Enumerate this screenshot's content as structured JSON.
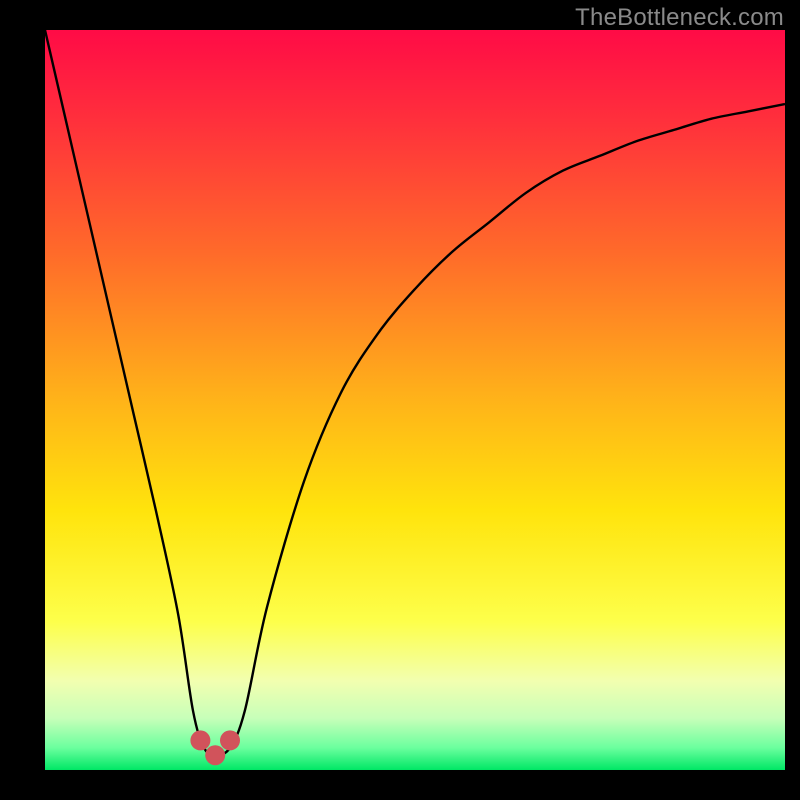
{
  "watermark": "TheBottleneck.com",
  "chart_data": {
    "type": "line",
    "title": "",
    "xlabel": "",
    "ylabel": "",
    "xlim": [
      0,
      100
    ],
    "ylim": [
      0,
      100
    ],
    "legend": false,
    "grid": false,
    "background": {
      "gradient_stops": [
        {
          "pos": 0.0,
          "color": "#ff0b46"
        },
        {
          "pos": 0.12,
          "color": "#ff2f3c"
        },
        {
          "pos": 0.3,
          "color": "#ff6a2a"
        },
        {
          "pos": 0.5,
          "color": "#ffb319"
        },
        {
          "pos": 0.65,
          "color": "#ffe40c"
        },
        {
          "pos": 0.8,
          "color": "#fdff4b"
        },
        {
          "pos": 0.88,
          "color": "#f2ffb0"
        },
        {
          "pos": 0.93,
          "color": "#c7ffb9"
        },
        {
          "pos": 0.97,
          "color": "#6bff9e"
        },
        {
          "pos": 1.0,
          "color": "#00e765"
        }
      ]
    },
    "series": [
      {
        "name": "bottleneck-curve",
        "x": [
          0,
          3,
          6,
          9,
          12,
          15,
          18,
          20,
          21.5,
          23,
          25,
          27,
          30,
          35,
          40,
          45,
          50,
          55,
          60,
          65,
          70,
          75,
          80,
          85,
          90,
          95,
          100
        ],
        "y": [
          100,
          87,
          74,
          61,
          48,
          35,
          21,
          8,
          3,
          2,
          3,
          8,
          22,
          39,
          51,
          59,
          65,
          70,
          74,
          78,
          81,
          83,
          85,
          86.5,
          88,
          89,
          90
        ]
      }
    ],
    "markers": [
      {
        "name": "min-marker-left",
        "x": 21.0,
        "y": 4,
        "color": "#d1535b",
        "size": 20
      },
      {
        "name": "min-marker-bottom",
        "x": 23.0,
        "y": 2,
        "color": "#d1535b",
        "size": 20
      },
      {
        "name": "min-marker-right",
        "x": 25.0,
        "y": 4,
        "color": "#d1535b",
        "size": 20
      }
    ]
  }
}
